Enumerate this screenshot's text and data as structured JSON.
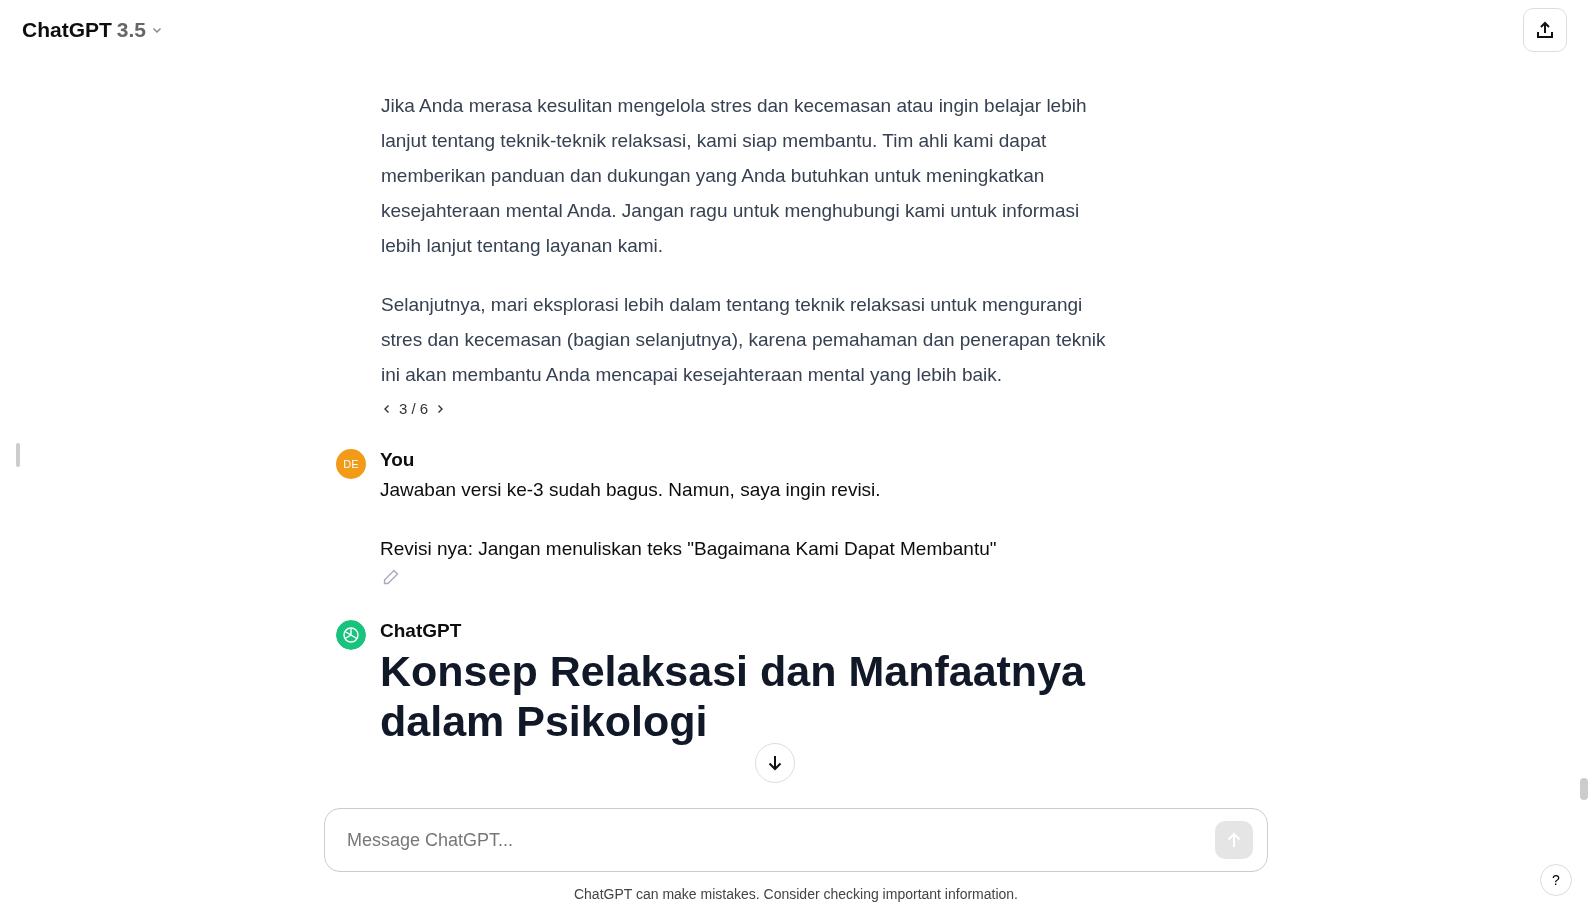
{
  "header": {
    "model_name": "ChatGPT",
    "model_version": "3.5"
  },
  "messages": [
    {
      "kind": "assistant_tail",
      "paragraphs": [
        "Jika Anda merasa kesulitan mengelola stres dan kecemasan atau ingin belajar lebih lanjut tentang teknik-teknik relaksasi, kami siap membantu. Tim ahli kami dapat memberikan panduan dan dukungan yang Anda butuhkan untuk meningkatkan kesejahteraan mental Anda. Jangan ragu untuk menghubungi kami untuk informasi lebih lanjut tentang layanan kami.",
        "Selanjutnya, mari eksplorasi lebih dalam tentang teknik relaksasi untuk mengurangi stres dan kecemasan (bagian selanjutnya), karena pemahaman dan penerapan teknik ini akan membantu Anda mencapai kesejahteraan mental yang lebih baik."
      ],
      "pager": "3 / 6"
    },
    {
      "kind": "user",
      "author": "You",
      "avatar": "DE",
      "paragraphs": [
        "Jawaban versi ke-3 sudah bagus. Namun, saya ingin revisi.",
        "Revisi nya: Jangan menuliskan teks \"Bagaimana Kami Dapat Membantu\""
      ]
    },
    {
      "kind": "assistant",
      "author": "ChatGPT",
      "heading": "Konsep Relaksasi dan Manfaatnya dalam Psikologi"
    }
  ],
  "composer": {
    "placeholder": "Message ChatGPT..."
  },
  "disclaimer": "ChatGPT can make mistakes. Consider checking important information.",
  "help": "?"
}
